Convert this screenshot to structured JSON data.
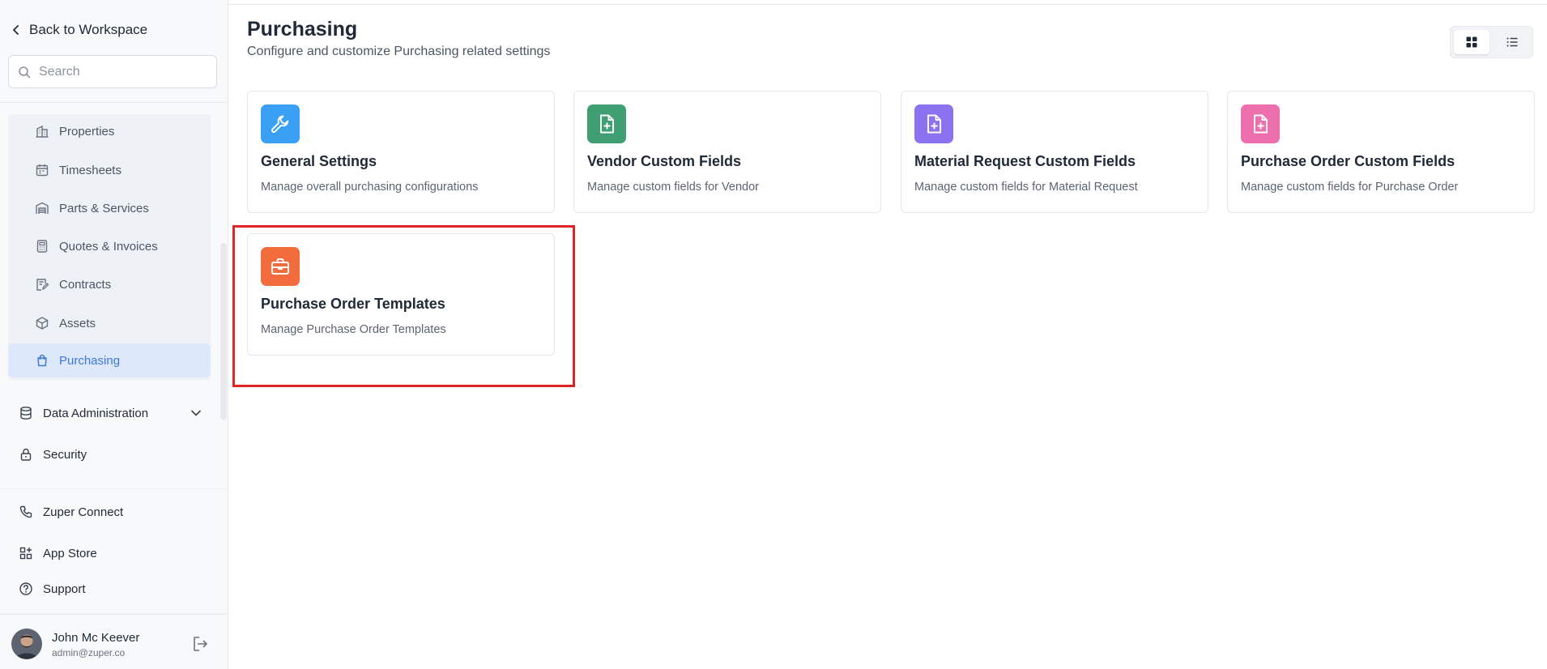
{
  "sidebar": {
    "back_label": "Back to Workspace",
    "search_placeholder": "Search",
    "sub_items": [
      {
        "label": "Properties",
        "icon": "building-icon"
      },
      {
        "label": "Timesheets",
        "icon": "calendar-icon"
      },
      {
        "label": "Parts & Services",
        "icon": "warehouse-icon"
      },
      {
        "label": "Quotes & Invoices",
        "icon": "calculator-icon"
      },
      {
        "label": "Contracts",
        "icon": "contract-icon"
      },
      {
        "label": "Assets",
        "icon": "cube-icon"
      },
      {
        "label": "Purchasing",
        "icon": "shopping-bag-icon",
        "active": true
      }
    ],
    "data_admin_label": "Data Administration",
    "security_label": "Security",
    "zuper_connect_label": "Zuper Connect",
    "app_store_label": "App Store",
    "support_label": "Support",
    "active_color": "#3d78d8"
  },
  "user": {
    "name": "John Mc Keever",
    "email": "admin@zuper.co"
  },
  "page": {
    "title": "Purchasing",
    "subtitle": "Configure and customize Purchasing related settings"
  },
  "cards": [
    {
      "title": "General Settings",
      "desc": "Manage overall purchasing configurations",
      "color": "#3aa0f5",
      "icon": "wrench-icon"
    },
    {
      "title": "Vendor Custom Fields",
      "desc": "Manage custom fields for Vendor",
      "color": "#3f9e72",
      "icon": "file-plus-icon"
    },
    {
      "title": "Material Request Custom Fields",
      "desc": "Manage custom fields for Material Request",
      "color": "#8b72f0",
      "icon": "file-plus-icon"
    },
    {
      "title": "Purchase Order Custom Fields",
      "desc": "Manage custom fields for Purchase Order",
      "color": "#ee6fae",
      "icon": "file-plus-icon"
    },
    {
      "title": "Purchase Order Templates",
      "desc": "Manage Purchase Order Templates",
      "color": "#f26c3d",
      "icon": "briefcase-icon"
    }
  ],
  "view_toggle": {
    "selected": "grid"
  }
}
